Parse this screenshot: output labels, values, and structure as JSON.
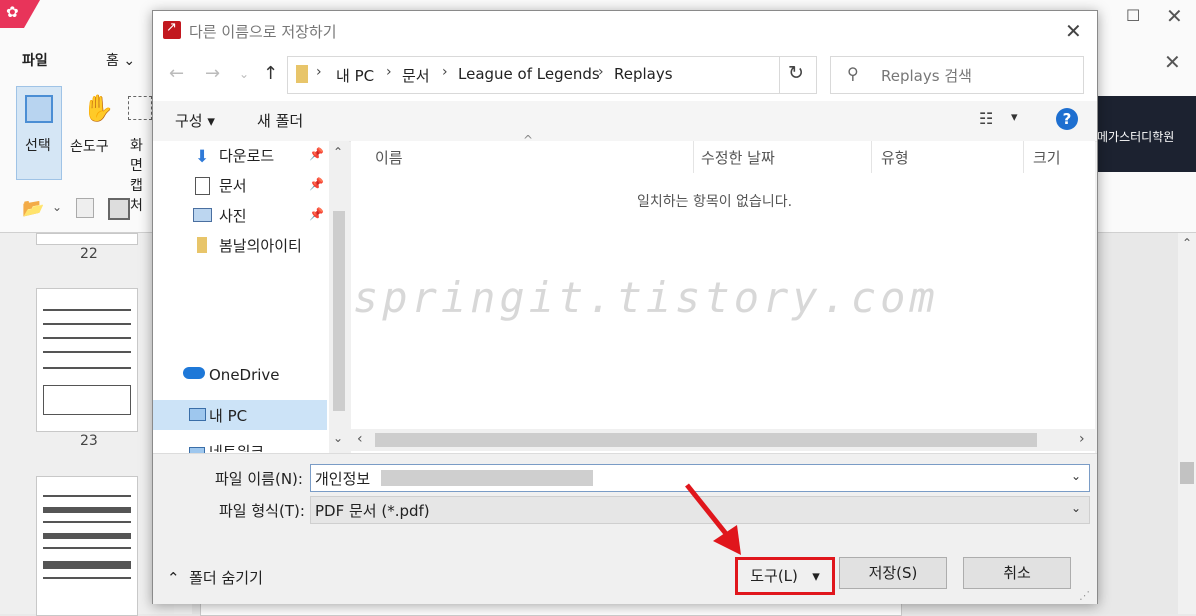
{
  "background_app": {
    "tab_file": "파일",
    "tab_home": "홈",
    "tools": [
      {
        "label": "선택"
      },
      {
        "label": "손도구"
      },
      {
        "label": "화면\n캡처"
      }
    ],
    "thumbs": [
      {
        "page": "22"
      },
      {
        "page": "23"
      }
    ],
    "ad_text": "메가스터디학원"
  },
  "dialog": {
    "title": "다른 이름으로 저장하기",
    "address": {
      "crumbs": [
        "내 PC",
        "문서",
        "League of Legends",
        "Replays"
      ]
    },
    "search": {
      "placeholder": "Replays 검색"
    },
    "toolbar": {
      "organize": "구성 ▾",
      "new_folder": "새 폴더"
    },
    "nav": {
      "items": [
        {
          "label": "다운로드",
          "icon": "download-icon",
          "pinned": true
        },
        {
          "label": "문서",
          "icon": "document-icon",
          "pinned": true
        },
        {
          "label": "사진",
          "icon": "picture-icon",
          "pinned": true
        },
        {
          "label": "봄날의아이티",
          "icon": "folder-icon",
          "pinned": false
        },
        {
          "label": "OneDrive",
          "icon": "cloud-icon",
          "pinned": false
        },
        {
          "label": "내 PC",
          "icon": "computer-icon",
          "pinned": false,
          "selected": true
        },
        {
          "label": "네트워크",
          "icon": "network-icon",
          "pinned": false
        }
      ]
    },
    "columns": [
      "이름",
      "수정한 날짜",
      "유형",
      "크기"
    ],
    "empty_message": "일치하는 항목이 없습니다.",
    "watermark": "springit.tistory.com",
    "filename": {
      "label": "파일 이름(N):",
      "value": "개인정보"
    },
    "filetype": {
      "label": "파일 형식(T):",
      "value": "PDF 문서 (*.pdf)"
    },
    "hide_folders": "폴더 숨기기",
    "buttons": {
      "tools": "도구(L)",
      "save": "저장(S)",
      "cancel": "취소"
    }
  },
  "colors": {
    "highlight_border": "#e0161c",
    "accent_blue": "#1e6fd0",
    "selection": "#cce3f7"
  }
}
